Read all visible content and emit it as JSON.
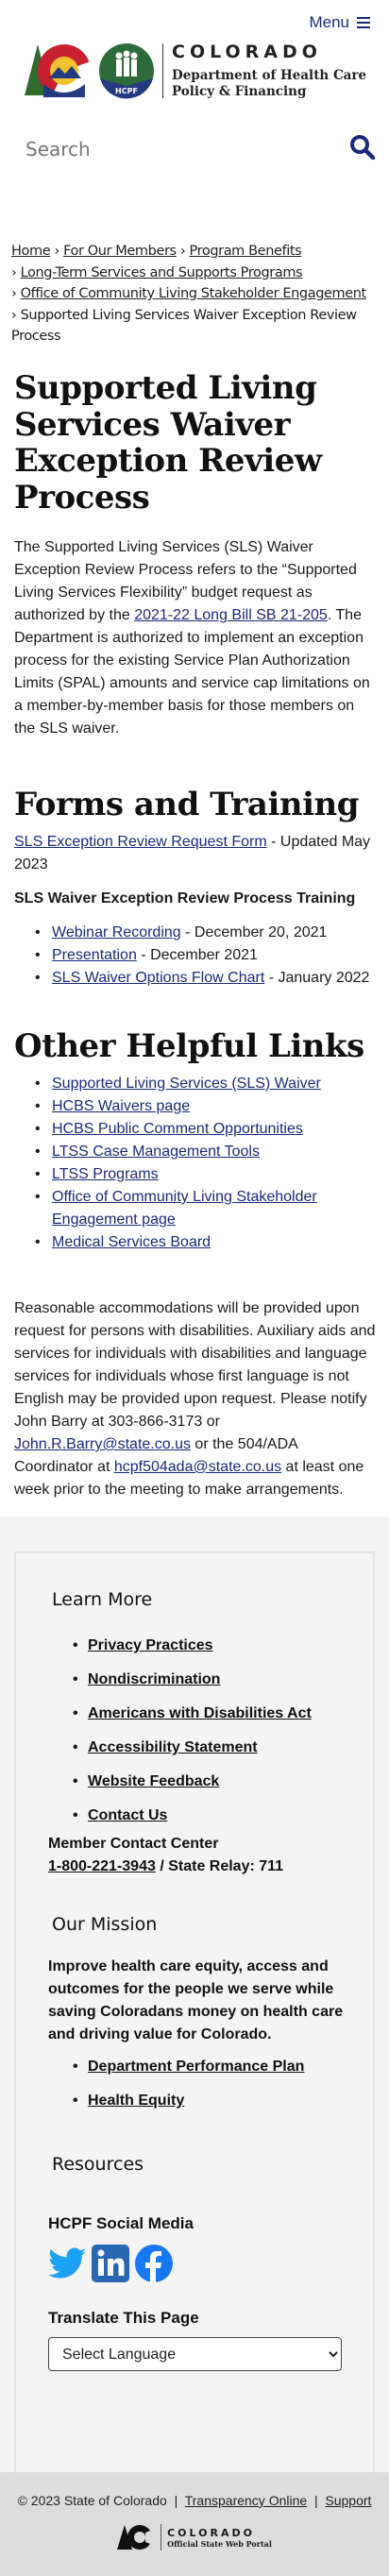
{
  "header": {
    "menu_label": "Menu",
    "logo": {
      "state": "COLORADO",
      "dept_line1": "Department of Health Care",
      "dept_line2": "Policy & Financing",
      "hcpf_badge": "HCPF"
    },
    "search_placeholder": "Search"
  },
  "breadcrumb": [
    "Home",
    "For Our Members",
    "Program Benefits",
    "Long-Term Services and Supports Programs",
    "Office of Community Living Stakeholder Engagement",
    "Supported Living Services Waiver Exception Review Process"
  ],
  "main": {
    "title": "Supported Living Services Waiver Exception Review Process",
    "intro_before": "The Supported Living Services (SLS) Waiver Exception Review Process refers to the “Supported Living Services Flexibility” budget request as authorized by the ",
    "intro_link": "2021-22 Long Bill SB 21-205",
    "intro_after": ". The Department is authorized to implement an exception process for the existing Service Plan Authorization Limits (SPAL) amounts and service cap limitations on a member-by-member basis for those members on the SLS waiver.",
    "forms_heading": "Forms and Training",
    "form_link": "SLS Exception Review Request Form",
    "form_suffix": " - Updated May 2023",
    "training_heading": "SLS Waiver Exception Review Process Training",
    "training": [
      {
        "link": "Webinar Recording",
        "suffix": " - December 20, 2021"
      },
      {
        "link": "Presentation",
        "suffix": " - December 2021"
      },
      {
        "link": "SLS Waiver Options Flow Chart",
        "suffix": " - January 2022"
      }
    ],
    "links_heading": "Other Helpful Links",
    "links": [
      "Supported Living Services (SLS) Waiver",
      "HCBS Waivers page",
      "HCBS Public Comment Opportunities",
      "LTSS Case Management Tools",
      "LTSS Programs",
      "Office of Community Living Stakeholder Engagement page",
      "Medical Services Board"
    ],
    "accom_before": "Reasonable accommodations will be provided upon request for persons with disabilities. Auxiliary aids and services for individuals with disabilities and language services for individuals whose first language is not English may be provided upon request. Please notify John Barry at 303-866-3173 or ",
    "accom_email1": "John.R.Barry@state.co.us",
    "accom_mid": " or the 504/ADA Coordinator at ",
    "accom_email2": "hcpf504ada@state.co.us",
    "accom_after": " at least one week prior to the meeting to make arrangements."
  },
  "footer": {
    "learn_more": "Learn More",
    "learn_links": [
      "Privacy Practices",
      "Nondiscrimination",
      "Americans with Disabilities Act",
      "Accessibility Statement",
      "Website Feedback",
      "Contact Us"
    ],
    "contact_label": "Member Contact Center",
    "phone": "1-800-221-3943",
    "relay": " / State Relay: 711",
    "mission_heading": "Our Mission",
    "mission_text": "Improve health care equity, access and outcomes for the people we serve while saving Coloradans money on health care and driving value for Colorado.",
    "mission_links": [
      "Department Performance Plan",
      "Health Equity"
    ],
    "resources": "Resources",
    "social_heading": "HCPF Social Media",
    "social": [
      "twitter-icon",
      "linkedin-icon",
      "facebook-icon"
    ],
    "translate_heading": "Translate This Page",
    "language_select": "Select Language",
    "copyright": "© 2023 State of Colorado",
    "sep": "|",
    "transparency": "Transparency Online",
    "support": "Support",
    "portal_logo": {
      "state": "COLORADO",
      "tagline": "Official State Web Portal"
    }
  },
  "colors": {
    "link": "#1a2a7a",
    "twitter": "#1da1f2",
    "linkedin": "#2867b2",
    "facebook": "#1877f2",
    "footer_bg": "#f4f4f4",
    "bottom_bg": "#dcdcdc"
  }
}
